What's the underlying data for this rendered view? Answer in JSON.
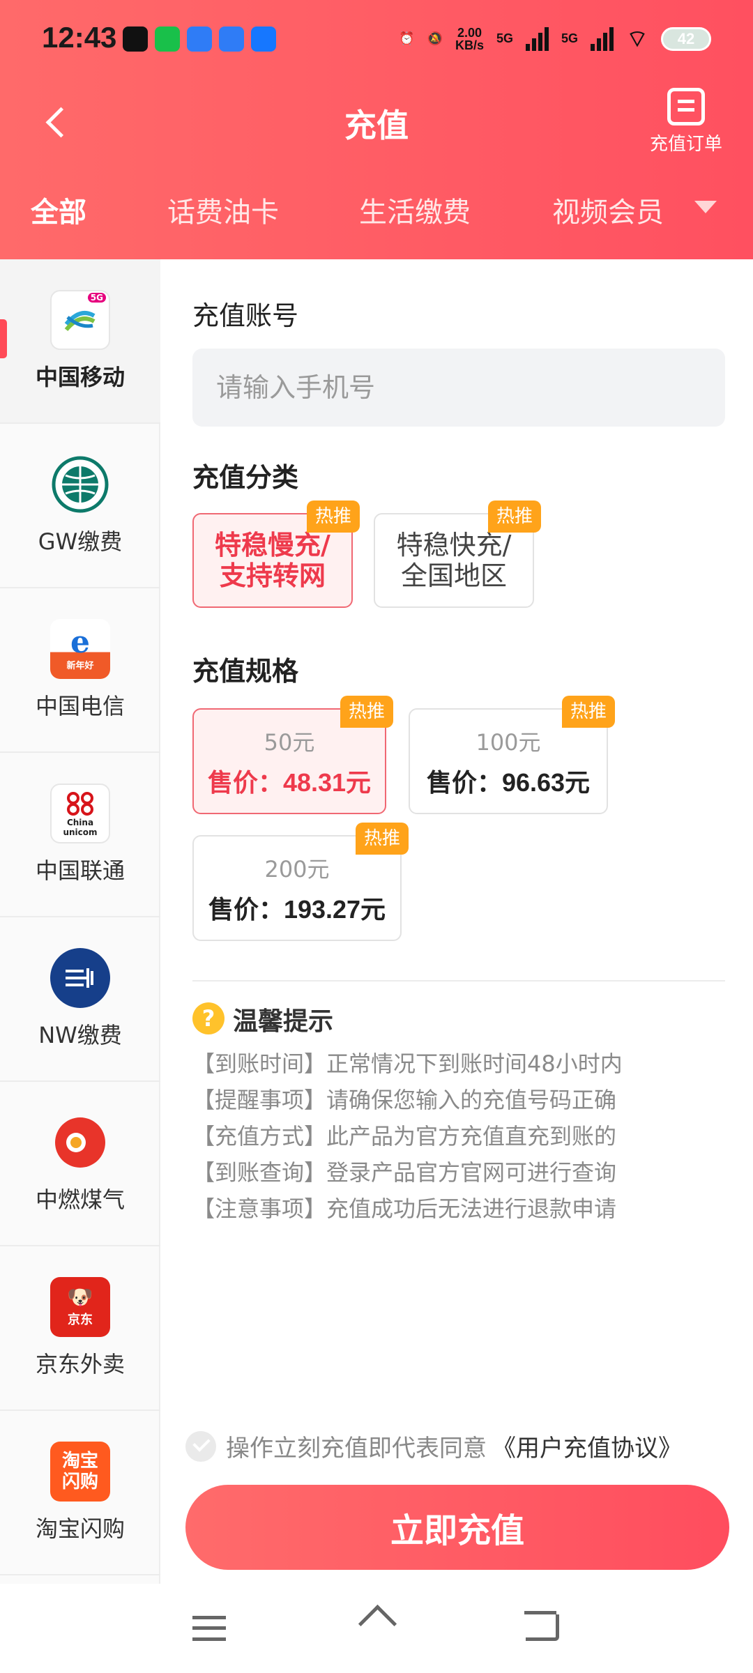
{
  "status_bar": {
    "time": "12:43",
    "net_speed_value": "2.00",
    "net_speed_unit": "KB/s",
    "sim1": "5G",
    "sim2": "5G",
    "battery": "42"
  },
  "nav": {
    "title": "充值",
    "order_label": "充值订单"
  },
  "tabs": [
    {
      "label": "全部",
      "active": true
    },
    {
      "label": "话费油卡",
      "active": false
    },
    {
      "label": "生活缴费",
      "active": false
    },
    {
      "label": "视频会员",
      "active": false
    }
  ],
  "sidebar": {
    "items": [
      {
        "label": "中国移动",
        "icon": "china-mobile-logo",
        "active": true
      },
      {
        "label": "GW缴费",
        "icon": "state-grid-logo",
        "active": false
      },
      {
        "label": "中国电信",
        "icon": "china-telecom-logo",
        "active": false
      },
      {
        "label": "中国联通",
        "icon": "china-unicom-logo",
        "active": false
      },
      {
        "label": "NW缴费",
        "icon": "southern-grid-logo",
        "active": false
      },
      {
        "label": "中燃煤气",
        "icon": "china-gas-logo",
        "active": false
      },
      {
        "label": "京东外卖",
        "icon": "jd-logo",
        "active": false
      },
      {
        "label": "淘宝闪购",
        "icon": "taobao-flash-logo",
        "active": false
      }
    ],
    "logo_texts": {
      "mobile_badge": "5G",
      "telecom_badge": "新年好",
      "unicom_text": "China unicom",
      "jd_text": "京东",
      "taobao_text": "淘宝闪购"
    }
  },
  "account": {
    "label": "充值账号",
    "placeholder": "请输入手机号"
  },
  "category": {
    "label": "充值分类",
    "options": [
      {
        "line1": "特稳慢充/",
        "line2": "支持转网",
        "badge": "热推",
        "selected": true
      },
      {
        "line1": "特稳快充/",
        "line2": "全国地区",
        "badge": "热推",
        "selected": false
      }
    ]
  },
  "spec": {
    "label": "充值规格",
    "options": [
      {
        "face": "50元",
        "price": "售价：48.31元",
        "badge": "热推",
        "selected": true
      },
      {
        "face": "100元",
        "price": "售价：96.63元",
        "badge": "热推",
        "selected": false
      },
      {
        "face": "200元",
        "price": "售价：193.27元",
        "badge": "热推",
        "selected": false
      }
    ]
  },
  "tips": {
    "icon": "?",
    "title": "温馨提示",
    "items": [
      "【到账时间】正常情况下到账时间48小时内",
      "【提醒事项】请确保您输入的充值号码正确",
      "【充值方式】此产品为官方充值直充到账的",
      "【到账查询】登录产品官方官网可进行查询",
      "【注意事项】充值成功后无法进行退款申请"
    ]
  },
  "footer": {
    "agree_text": "操作立刻充值即代表同意",
    "agreement_link": "《用户充值协议》",
    "pay_button": "立即充值"
  },
  "colors": {
    "accent": "#ff5060",
    "hot_badge": "#ffa31a",
    "selected_text": "#ee3a4c"
  }
}
